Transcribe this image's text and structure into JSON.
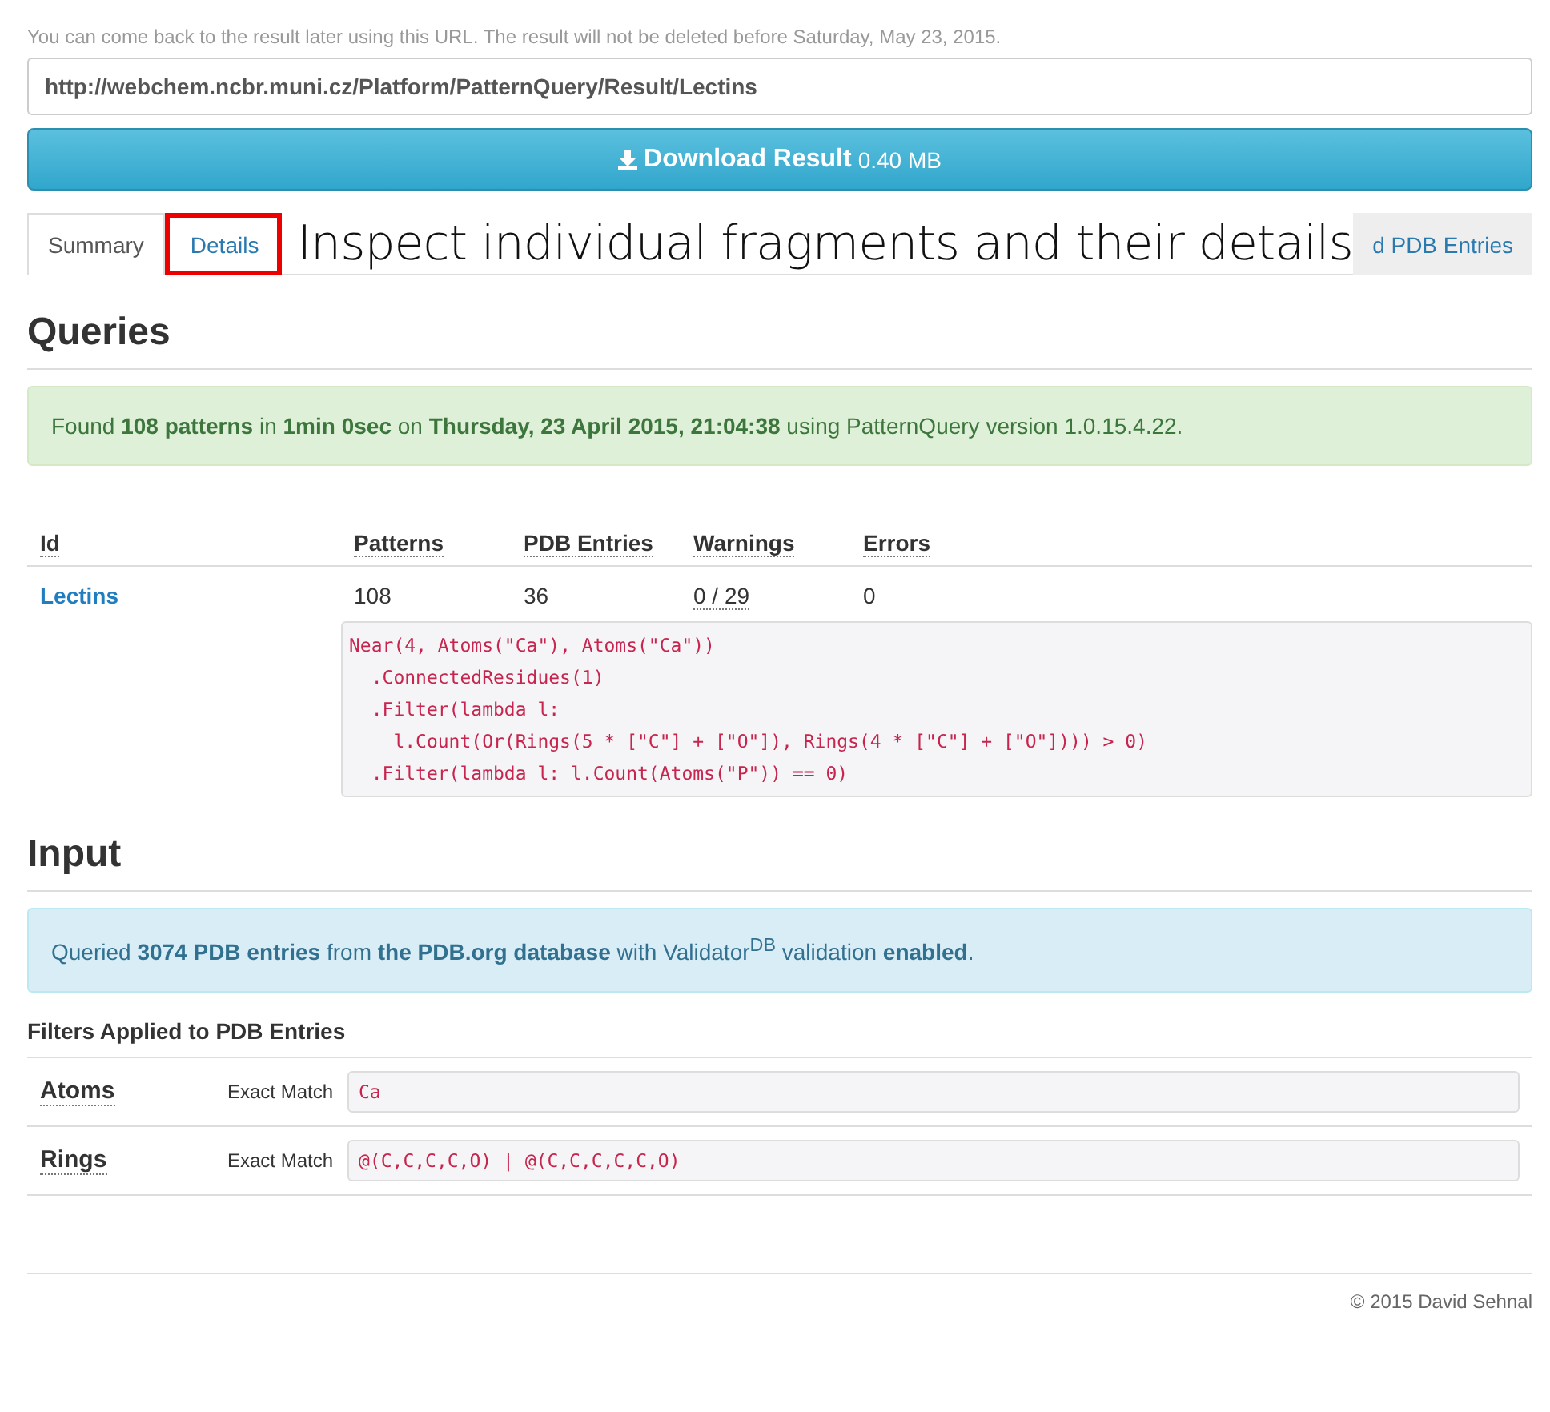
{
  "notice": "You can come back to the result later using this URL. The result will not be deleted before Saturday, May 23, 2015.",
  "url": "http://webchem.ncbr.muni.cz/Platform/PatternQuery/Result/Lectins",
  "download": {
    "label": "Download Result",
    "size": "0.40 MB"
  },
  "tabs": [
    {
      "label": "Summary",
      "selected": true,
      "highlighted": false
    },
    {
      "label": "Details",
      "selected": false,
      "highlighted": true
    },
    {
      "label": "d PDB Entries",
      "selected": false,
      "highlighted": false
    }
  ],
  "annotation": "Inspect individual fragments and their details",
  "queries": {
    "heading": "Queries",
    "alert": "Found **108 patterns** in **1min 0sec** on **Thursday, 23 April 2015, 21:04:38** using PatternQuery version 1.0.15.4.22.",
    "columns": [
      "Id",
      "Patterns",
      "PDB Entries",
      "Warnings",
      "Errors"
    ],
    "rows": [
      {
        "id": "Lectins",
        "patterns": "108",
        "pdb_entries": "36",
        "warnings": "0 / 29",
        "errors": "0",
        "code": [
          "Near(4, Atoms(\"Ca\"), Atoms(\"Ca\"))",
          "  .ConnectedResidues(1)",
          "  .Filter(lambda l:",
          "    l.Count(Or(Rings(5 * [\"C\"] + [\"O\"]), Rings(4 * [\"C\"] + [\"O\"]))) > 0)",
          "  .Filter(lambda l: l.Count(Atoms(\"P\")) == 0)"
        ]
      }
    ]
  },
  "input": {
    "heading": "Input",
    "alert": "Queried **3074 PDB entries** from **the PDB.org database** with Validator$^{DB}$ validation **enabled**.",
    "filters_title": "Filters Applied to PDB Entries",
    "filters": [
      {
        "name": "Atoms",
        "match": "Exact Match",
        "value": "Ca"
      },
      {
        "name": "Rings",
        "match": "Exact Match",
        "value": "@(C,C,C,C,O) | @(C,C,C,C,C,O)"
      }
    ]
  },
  "footer": "© 2015 David Sehnal"
}
